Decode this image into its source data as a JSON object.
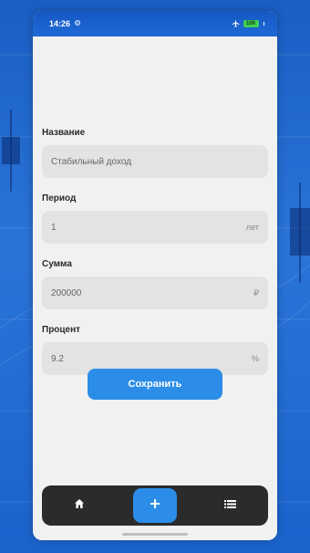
{
  "status_bar": {
    "time": "14:26",
    "battery": "100"
  },
  "form": {
    "fields": [
      {
        "label": "Название",
        "value": "Стабильный доход",
        "unit": ""
      },
      {
        "label": "Период",
        "value": "1",
        "unit": "лет"
      },
      {
        "label": "Сумма",
        "value": "200000",
        "unit": "₽"
      },
      {
        "label": "Процент",
        "value": "9.2",
        "unit": "%"
      }
    ],
    "save_label": "Сохранить"
  },
  "nav": {
    "items": [
      {
        "icon": "home-icon"
      },
      {
        "icon": "plus-icon",
        "active": true
      },
      {
        "icon": "list-icon"
      }
    ]
  },
  "colors": {
    "accent": "#2b8de8",
    "nav_bg": "#2b2b2b",
    "field_bg": "#e3e3e3",
    "screen_bg": "#f1f1f1",
    "wallpaper": "#1f63c8"
  }
}
